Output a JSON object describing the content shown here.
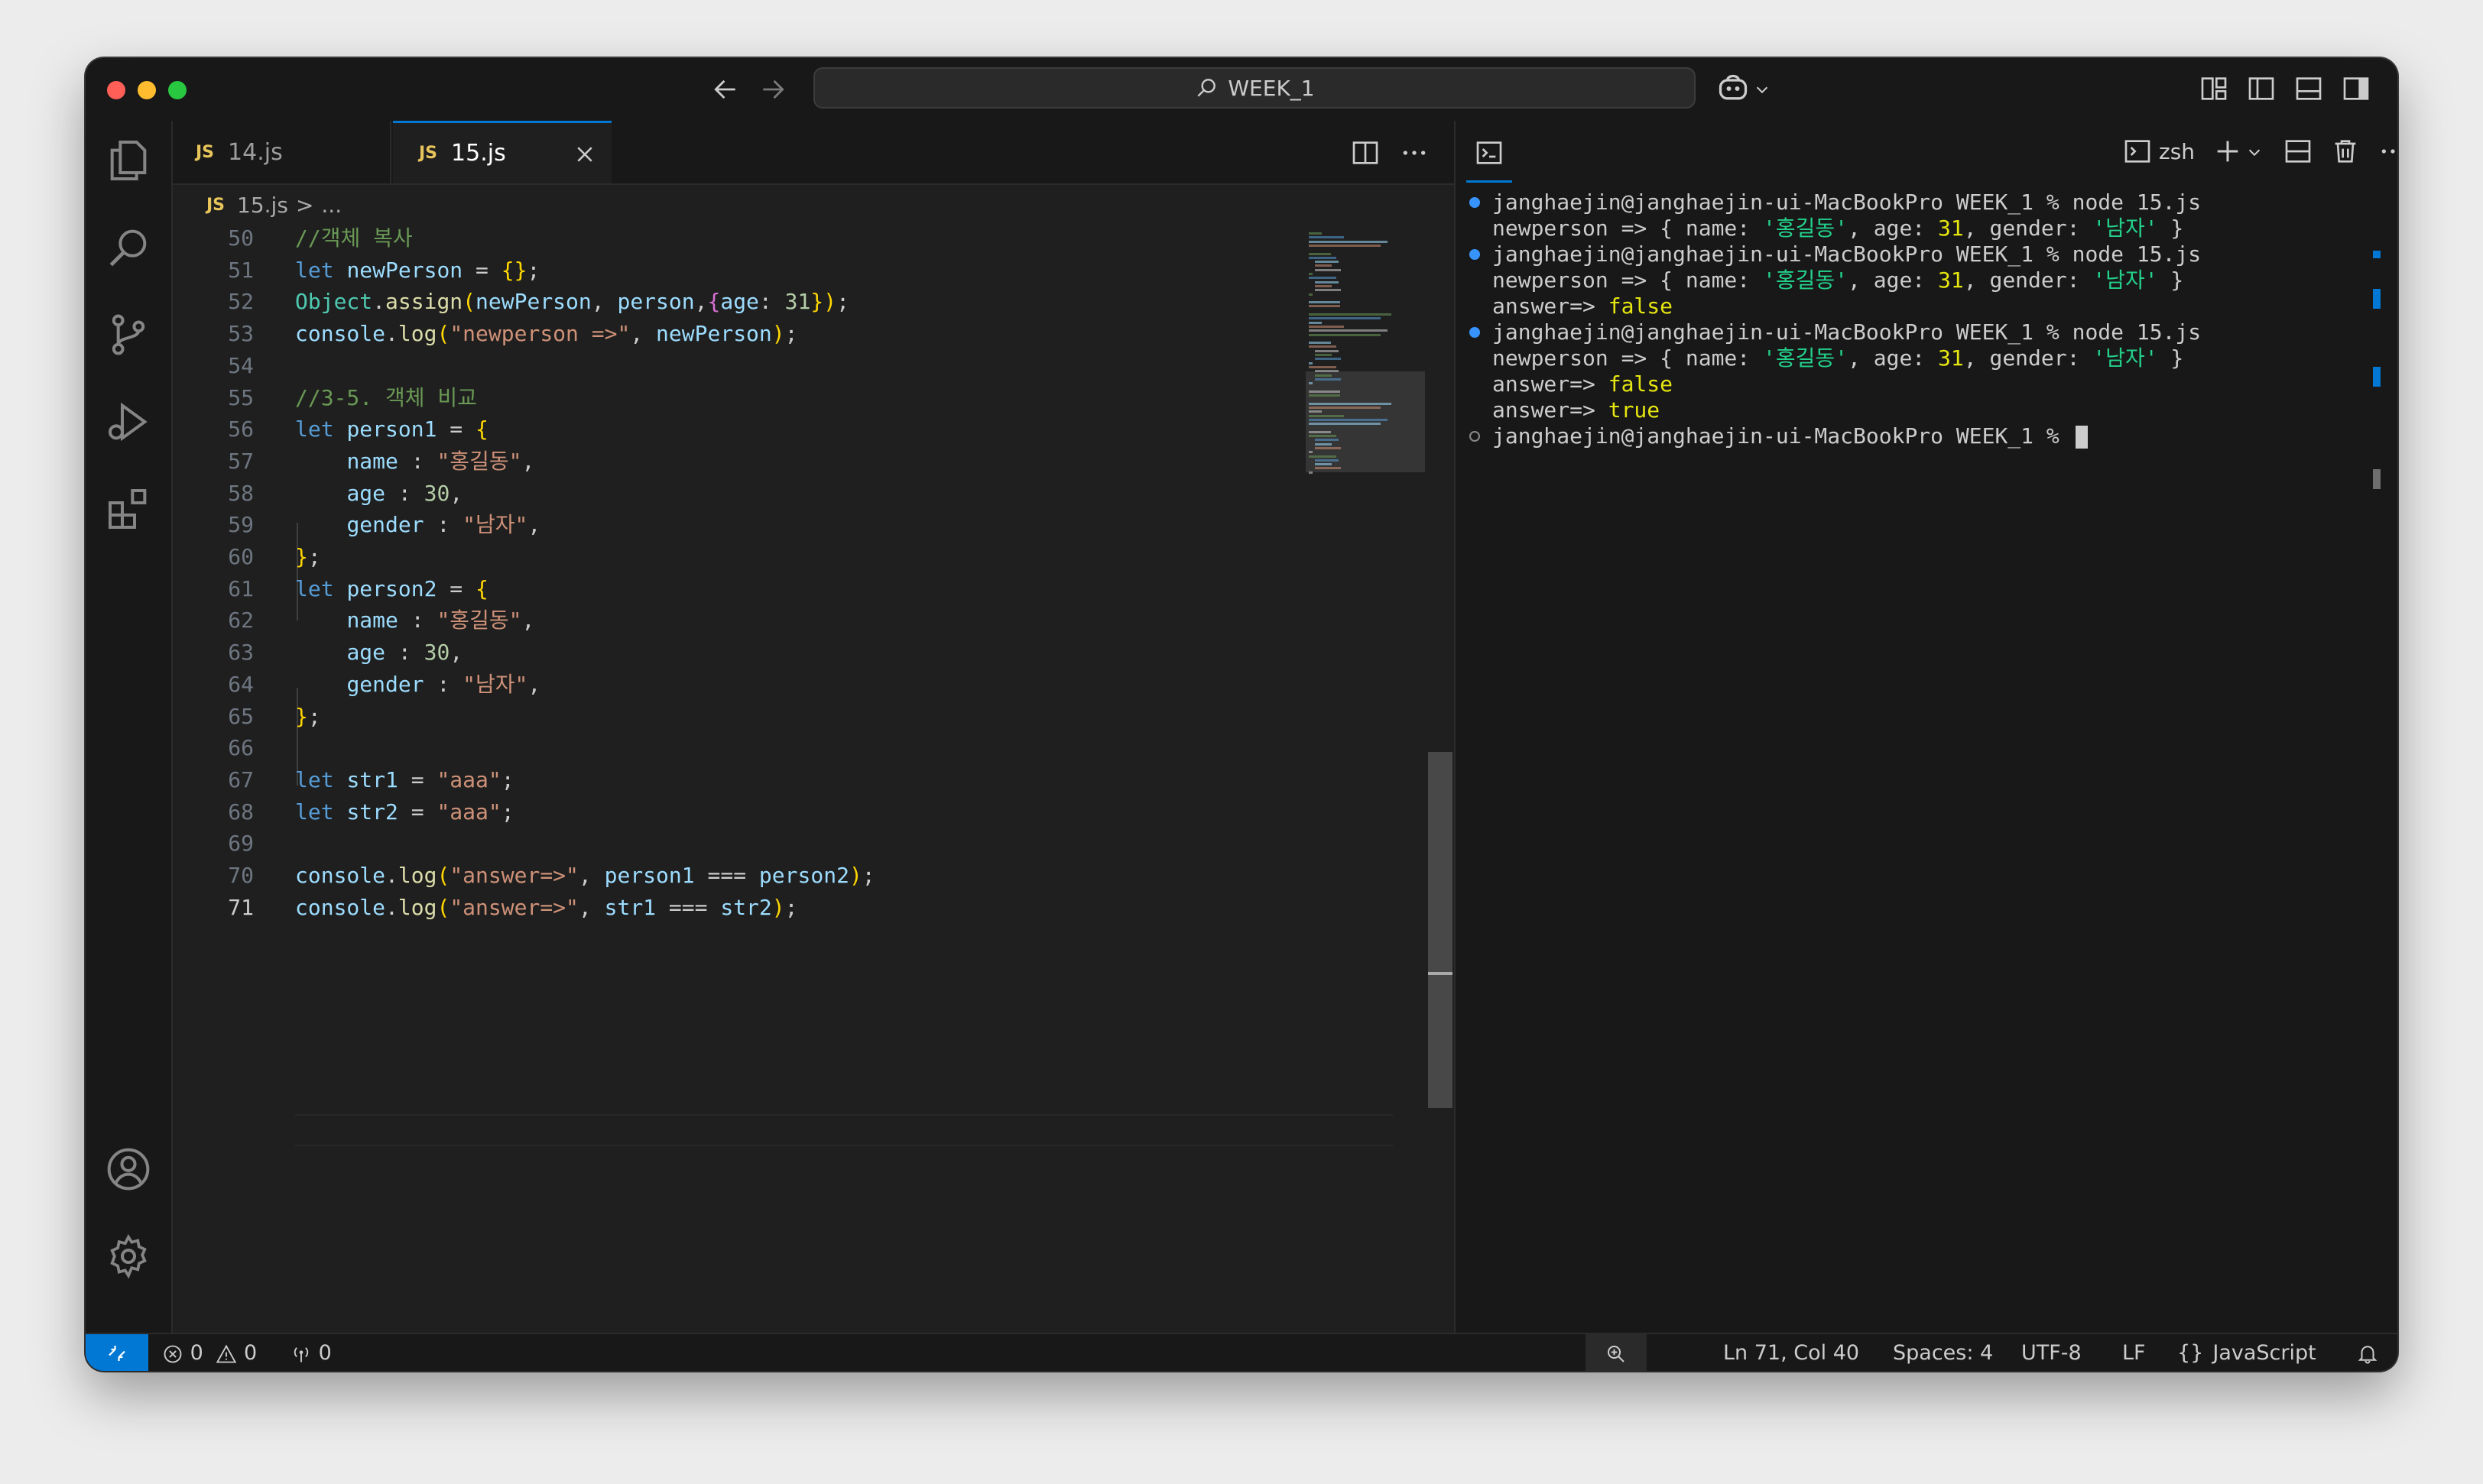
{
  "window": {
    "search_title": "WEEK_1"
  },
  "tabs": [
    {
      "icon": "JS",
      "label": "14.js",
      "active": false
    },
    {
      "icon": "JS",
      "label": "15.js",
      "active": true
    }
  ],
  "breadcrumb": {
    "icon": "JS",
    "file": "15.js",
    "separator": ">",
    "rest": "..."
  },
  "editor": {
    "language": "javascript",
    "current_line": 71,
    "lines": [
      {
        "n": 50,
        "code": "//객체 복사"
      },
      {
        "n": 51,
        "code": "let newPerson = {};"
      },
      {
        "n": 52,
        "code": "Object.assign(newPerson, person,{age: 31});"
      },
      {
        "n": 53,
        "code": "console.log(\"newperson =>\", newPerson);"
      },
      {
        "n": 54,
        "code": ""
      },
      {
        "n": 55,
        "code": "//3-5. 객체 비교"
      },
      {
        "n": 56,
        "code": "let person1 = {"
      },
      {
        "n": 57,
        "code": "    name : \"홍길동\","
      },
      {
        "n": 58,
        "code": "    age : 30,"
      },
      {
        "n": 59,
        "code": "    gender : \"남자\","
      },
      {
        "n": 60,
        "code": "};"
      },
      {
        "n": 61,
        "code": "let person2 = {"
      },
      {
        "n": 62,
        "code": "    name : \"홍길동\","
      },
      {
        "n": 63,
        "code": "    age : 30,"
      },
      {
        "n": 64,
        "code": "    gender : \"남자\","
      },
      {
        "n": 65,
        "code": "};"
      },
      {
        "n": 66,
        "code": ""
      },
      {
        "n": 67,
        "code": "let str1 = \"aaa\";"
      },
      {
        "n": 68,
        "code": "let str2 = \"aaa\";"
      },
      {
        "n": 69,
        "code": ""
      },
      {
        "n": 70,
        "code": "console.log(\"answer=>\", person1 === person2);"
      },
      {
        "n": 71,
        "code": "console.log(\"answer=>\", str1 === str2);"
      }
    ]
  },
  "terminal": {
    "shell": "zsh",
    "lines": [
      {
        "marker": "filled",
        "parts": [
          {
            "t": "janghaejin@janghaejin-ui-MacBookPro WEEK_1 % node 15.js",
            "c": "plain"
          }
        ]
      },
      {
        "marker": "none",
        "parts": [
          {
            "t": "newperson => { name: ",
            "c": "plain"
          },
          {
            "t": "'홍길동'",
            "c": "grn"
          },
          {
            "t": ", age: ",
            "c": "plain"
          },
          {
            "t": "31",
            "c": "yel"
          },
          {
            "t": ", gender: ",
            "c": "plain"
          },
          {
            "t": "'남자'",
            "c": "grn"
          },
          {
            "t": " }",
            "c": "plain"
          }
        ]
      },
      {
        "marker": "filled",
        "parts": [
          {
            "t": "janghaejin@janghaejin-ui-MacBookPro WEEK_1 % node 15.js",
            "c": "plain"
          }
        ]
      },
      {
        "marker": "none",
        "parts": [
          {
            "t": "newperson => { name: ",
            "c": "plain"
          },
          {
            "t": "'홍길동'",
            "c": "grn"
          },
          {
            "t": ", age: ",
            "c": "plain"
          },
          {
            "t": "31",
            "c": "yel"
          },
          {
            "t": ", gender: ",
            "c": "plain"
          },
          {
            "t": "'남자'",
            "c": "grn"
          },
          {
            "t": " }",
            "c": "plain"
          }
        ]
      },
      {
        "marker": "none",
        "parts": [
          {
            "t": "answer=> ",
            "c": "plain"
          },
          {
            "t": "false",
            "c": "yel"
          }
        ]
      },
      {
        "marker": "filled",
        "parts": [
          {
            "t": "janghaejin@janghaejin-ui-MacBookPro WEEK_1 % node 15.js",
            "c": "plain"
          }
        ]
      },
      {
        "marker": "none",
        "parts": [
          {
            "t": "newperson => { name: ",
            "c": "plain"
          },
          {
            "t": "'홍길동'",
            "c": "grn"
          },
          {
            "t": ", age: ",
            "c": "plain"
          },
          {
            "t": "31",
            "c": "yel"
          },
          {
            "t": ", gender: ",
            "c": "plain"
          },
          {
            "t": "'남자'",
            "c": "grn"
          },
          {
            "t": " }",
            "c": "plain"
          }
        ]
      },
      {
        "marker": "none",
        "parts": [
          {
            "t": "answer=> ",
            "c": "plain"
          },
          {
            "t": "false",
            "c": "yel"
          }
        ]
      },
      {
        "marker": "none",
        "parts": [
          {
            "t": "answer=> ",
            "c": "plain"
          },
          {
            "t": "true",
            "c": "yel"
          }
        ]
      },
      {
        "marker": "hollow",
        "parts": [
          {
            "t": "janghaejin@janghaejin-ui-MacBookPro WEEK_1 % ",
            "c": "plain"
          }
        ],
        "cursor": true
      }
    ]
  },
  "statusbar": {
    "errors": "0",
    "warnings": "0",
    "ports": "0",
    "position": "Ln 71, Col 40",
    "spaces": "Spaces: 4",
    "encoding": "UTF-8",
    "eol": "LF",
    "language_braces": "{}",
    "language": "JavaScript"
  },
  "colors": {
    "accent": "#0078d4",
    "editor_bg": "#1f1f1f",
    "chrome_bg": "#181818",
    "keyword": "#569cd6",
    "string": "#ce9178",
    "comment": "#6a9955",
    "number": "#b5cea8",
    "terminal_yellow": "#e5e510",
    "terminal_green": "#23d18b"
  }
}
